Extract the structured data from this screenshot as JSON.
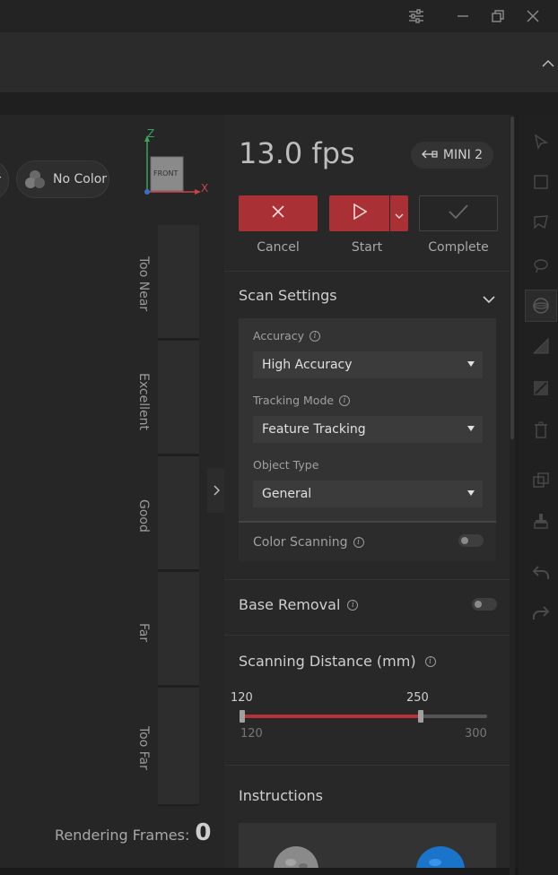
{
  "viewport": {
    "color_mode_partial": "or",
    "color_mode": "No Color",
    "axis_z": "Z",
    "axis_x": "X",
    "cube_face": "FRONT",
    "distance_levels": [
      "Too Near",
      "Excellent",
      "Good",
      "Far",
      "Too Far"
    ],
    "rendering_frames_label": "Rendering Frames:",
    "rendering_frames_value": "0"
  },
  "panel": {
    "fps": "13.0 fps",
    "device": "MINI 2",
    "actions": {
      "cancel": "Cancel",
      "start": "Start",
      "complete": "Complete"
    },
    "scan_settings": {
      "title": "Scan Settings",
      "accuracy_label": "Accuracy",
      "accuracy_value": "High Accuracy",
      "tracking_label": "Tracking Mode",
      "tracking_value": "Feature Tracking",
      "object_label": "Object Type",
      "object_value": "General",
      "color_scanning_label": "Color Scanning"
    },
    "base_removal": "Base Removal",
    "scanning_distance": {
      "title": "Scanning Distance (mm)",
      "low_value": 120,
      "high_value": 250,
      "min": 120,
      "max": 300
    },
    "instructions_title": "Instructions"
  },
  "colors": {
    "accent_red": "#a93035",
    "slider_red": "#b63238"
  }
}
